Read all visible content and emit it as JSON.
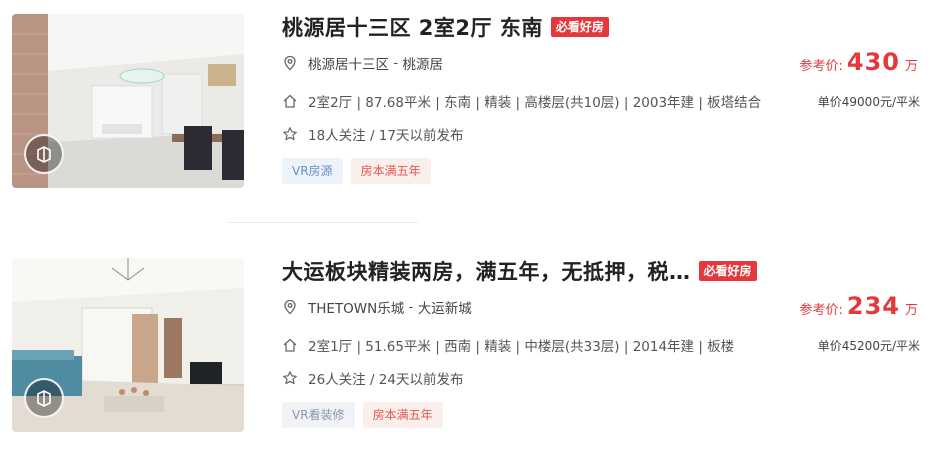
{
  "listings": [
    {
      "title": "桃源居十三区 2室2厅 东南",
      "badge": "必看好房",
      "community": "桃源居十三区",
      "area": "桃源居",
      "info": "2室2厅 | 87.68平米 | 东南 | 精装 | 高楼层(共10层) | 2003年建 | 板塔结合",
      "follow": "18人关注 / 17天以前发布",
      "tags": [
        "VR房源",
        "房本满五年"
      ],
      "price_label": "参考价:",
      "price_value": "430",
      "price_unit": "万",
      "unit_price": "单价49000元/平米"
    },
    {
      "title": "大运板块精装两房，满五年，无抵押，税…",
      "badge": "必看好房",
      "community": "THETOWN乐城",
      "area": "大运新城",
      "info": "2室1厅 | 51.65平米 | 西南 | 精装 | 中楼层(共33层) | 2014年建 | 板楼",
      "follow": "26人关注 / 24天以前发布",
      "tags": [
        "VR看装修",
        "房本满五年"
      ],
      "price_label": "参考价:",
      "price_value": "234",
      "price_unit": "万",
      "unit_price": "单价45200元/平米"
    }
  ],
  "separator": " - ",
  "icons": {
    "location": "location-pin-icon",
    "house": "house-icon",
    "star": "star-icon",
    "vr": "vr-panorama-icon"
  },
  "colors": {
    "accent": "#e4393c",
    "vr_tag": "#6a8fc7",
    "five_tag": "#e4574c"
  }
}
